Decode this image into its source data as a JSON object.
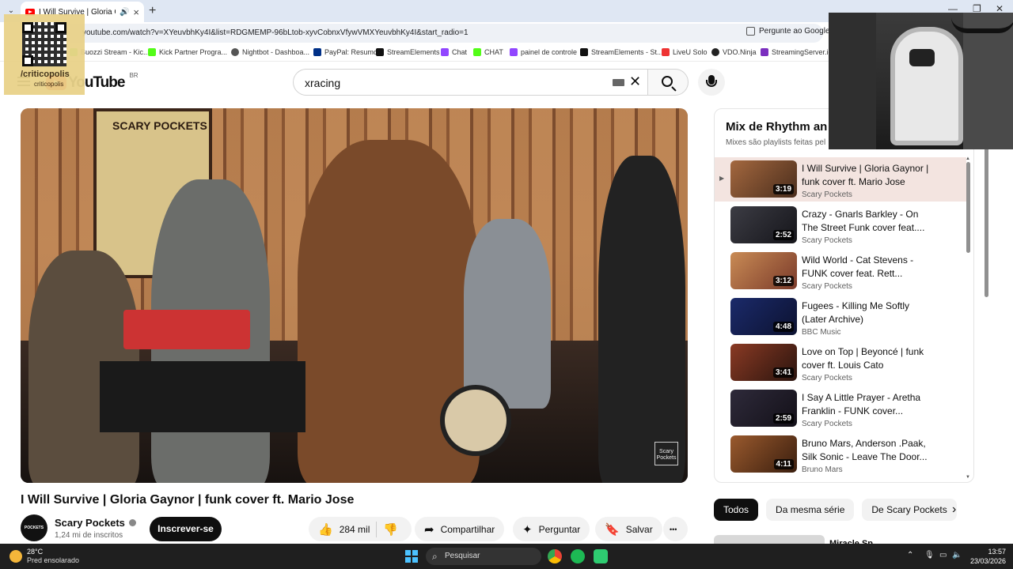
{
  "browser": {
    "tab_title": "I Will Survive | Gloria Gaynor",
    "url": "youtube.com/watch?v=XYeuvbhKy4I&list=RDGMEMP-96bLtob-xyvCobnxVfywVMXYeuvbhKy4I&start_radio=1",
    "ask_google": "Pergunte ao Google",
    "bookmarks": [
      "Buozzi Stream - Kic...",
      "Kick Partner Progra...",
      "Nightbot - Dashboa...",
      "PayPal: Resumo",
      "StreamElements",
      "Chat",
      "CHAT",
      "painel de controle",
      "StreamElements - St...",
      "LiveU Solo",
      "VDO.Ninja",
      "StreamingServer.io"
    ]
  },
  "header": {
    "logo_text": "YouTube",
    "country": "BR",
    "search_value": "xracing"
  },
  "video": {
    "title": "I Will Survive | Gloria Gaynor | funk cover ft. Mario Jose",
    "poster_text": "SCARY POCKETS",
    "watermark": "Scary Pockets",
    "channel_name": "Scary Pockets",
    "avatar_text": "POCKETS",
    "subscribers": "1,24 mi de inscritos",
    "subscribe_label": "Inscrever-se",
    "likes": "284 mil",
    "share_label": "Compartilhar",
    "ask_label": "Perguntar",
    "save_label": "Salvar",
    "more_label": "•••"
  },
  "playlist": {
    "title": "Mix de Rhythm an",
    "subtitle": "Mixes são playlists feitas pel",
    "items": [
      {
        "title": "I Will Survive | Gloria Gaynor | funk cover ft. Mario Jose",
        "channel": "Scary Pockets",
        "duration": "3:19"
      },
      {
        "title": "Crazy - Gnarls Barkley - On The Street Funk cover feat....",
        "channel": "Scary Pockets",
        "duration": "2:52"
      },
      {
        "title": "Wild World - Cat Stevens - FUNK cover feat. Rett...",
        "channel": "Scary Pockets",
        "duration": "3:12"
      },
      {
        "title": "Fugees - Killing Me Softly (Later Archive)",
        "channel": "BBC Music",
        "duration": "4:48"
      },
      {
        "title": "Love on Top | Beyoncé | funk cover ft. Louis Cato",
        "channel": "Scary Pockets",
        "duration": "3:41"
      },
      {
        "title": "I Say A Little Prayer - Aretha Franklin - FUNK cover...",
        "channel": "Scary Pockets",
        "duration": "2:59"
      },
      {
        "title": "Bruno Mars, Anderson .Paak, Silk Sonic - Leave The Door...",
        "channel": "Bruno Mars",
        "duration": "4:11"
      }
    ]
  },
  "chips": [
    "Todos",
    "Da mesma série",
    "De Scary Pockets"
  ],
  "next_video_title": "Miracle Sp...",
  "overlay": {
    "qr_label": "/criticopolis",
    "qr_label2": "criticopolis"
  },
  "taskbar": {
    "temp": "28°C",
    "condition": "Pred ensolarado",
    "search_placeholder": "Pesquisar",
    "time": "13:57",
    "date": "23/03/2026"
  },
  "colors": {
    "accent_red": "#ff0000",
    "active_item_bg": "#f3e4e0",
    "subscribe_bg": "#0f0f0f"
  }
}
